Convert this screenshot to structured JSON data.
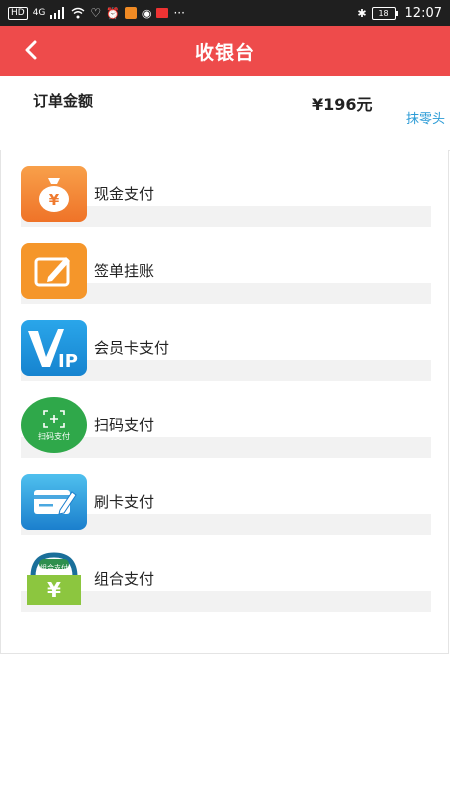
{
  "status_bar": {
    "network_tag": "HD",
    "signal_text": "4G",
    "time": "12:07",
    "battery": "18"
  },
  "header": {
    "title": "收银台"
  },
  "order": {
    "label": "订单金额",
    "amount": "¥196元",
    "round_off_label": "抹零头"
  },
  "payment_methods": [
    {
      "label": "现金支付",
      "icon": "money-bag-icon",
      "color": "#f58b3a"
    },
    {
      "label": "签单挂账",
      "icon": "sign-edit-icon",
      "color": "#f5962a"
    },
    {
      "label": "会员卡支付",
      "icon": "vip-icon",
      "color": "#1e9ae0"
    },
    {
      "label": "扫码支付",
      "icon": "scan-qr-icon",
      "color": "#2fa84a",
      "icon_text": "扫码支付"
    },
    {
      "label": "刷卡支付",
      "icon": "card-swipe-icon",
      "color": "#2b8fd6"
    },
    {
      "label": "组合支付",
      "icon": "combo-pay-icon",
      "color": "#8cc63f",
      "icon_text": "组合支付"
    }
  ],
  "colors": {
    "header_bg": "#ee4b4b",
    "round_off_link": "#2b9bd6"
  }
}
